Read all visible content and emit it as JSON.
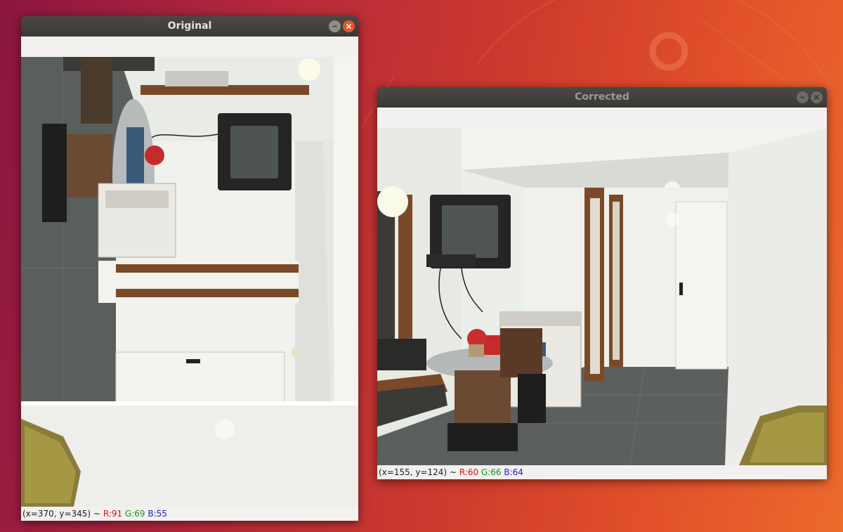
{
  "windows": {
    "original": {
      "title": "Original",
      "status": {
        "coords": "(x=370, y=345) ~",
        "r": "R:91",
        "g": "G:69",
        "b": "B:55"
      }
    },
    "corrected": {
      "title": "Corrected",
      "status": {
        "coords": "(x=155, y=124) ~",
        "r": "R:60",
        "g": "G:66",
        "b": "B:64"
      }
    }
  },
  "colors": {
    "titlebar_bg": "#3a3936",
    "close_button_active": "#e8572a",
    "toolbar_bg": "#f2f1f0",
    "status_r": "#e01010",
    "status_g": "#129a12",
    "status_b": "#1a1ad8"
  },
  "icons": {
    "minimize": "minimize-icon",
    "close": "close-icon"
  }
}
